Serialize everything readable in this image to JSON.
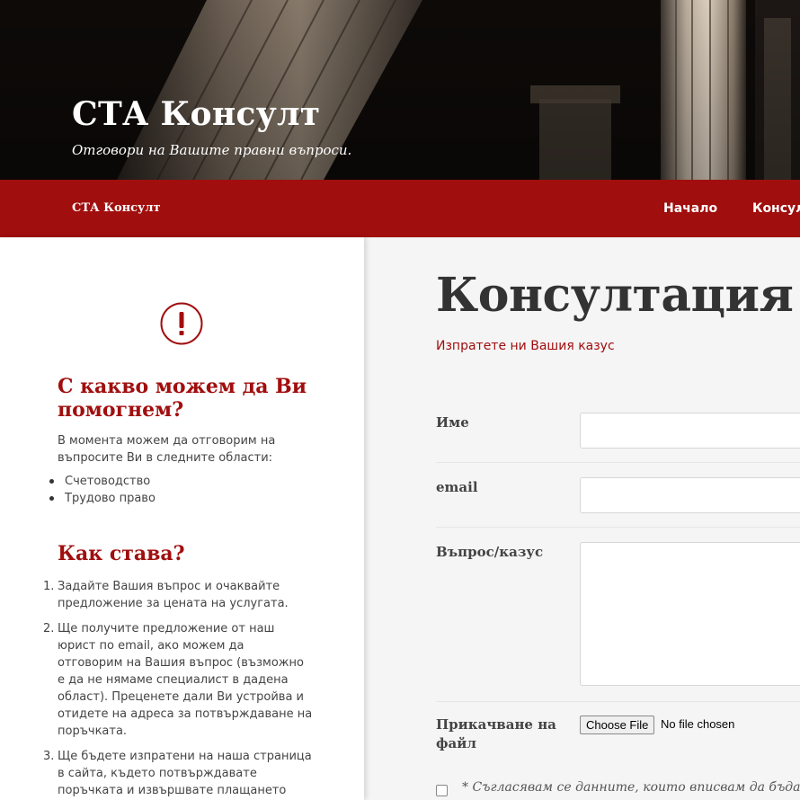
{
  "header": {
    "site_title": "СТА Консулт",
    "tagline": "Отговори на Вашите правни въпроси."
  },
  "nav": {
    "brand": "СТА Консулт",
    "links": [
      "Начало",
      "Консулт"
    ]
  },
  "sidebar": {
    "icon": "exclamation-circle-icon",
    "section1": {
      "heading": "С какво можем да Ви помогнем?",
      "intro": "В момента можем да отговорим на въпросите Ви в следните области:",
      "areas": [
        "Счетоводство",
        "Трудово право"
      ]
    },
    "section2": {
      "heading": "Как става?",
      "steps": [
        "Задайте Вашия въпрос и очаквайте предложение за цената на услугата.",
        "Ще получите предложение от наш юрист по email, ако можем да отговорим на Вашия въпрос (възможно е да не нямаме специалист в дадена област). Преценете дали Ви устройва и отидете на адреса за потвърждаване на поръчката.",
        "Ще бъдете изпратени на наша страница в сайта, където потвърждавате поръчката и извършвате плащането"
      ]
    }
  },
  "main": {
    "title": "Консултация",
    "subtitle": "Изпратете ни Вашия казус",
    "form": {
      "name_label": "Име",
      "email_label": "email",
      "question_label": "Въпрос/казус",
      "attach_label": "Прикачване на файл",
      "choose_file_button": "Choose File",
      "no_file_text": "No file chosen",
      "consent_text": "* Съгласявам се данните, които вписвам да бъдат из"
    }
  },
  "colors": {
    "brand_red": "#a10e0e",
    "header_dark": "#0b0908",
    "text_dark": "#333333"
  }
}
